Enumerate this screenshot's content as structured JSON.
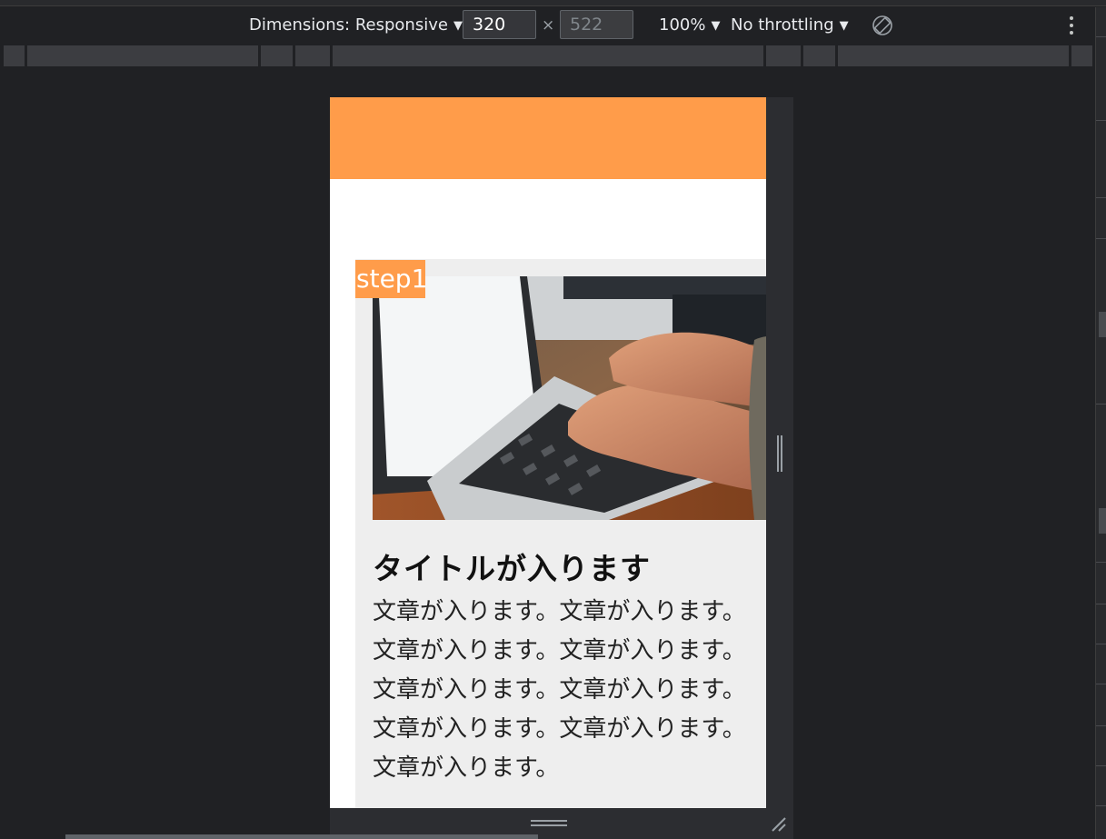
{
  "toolbar": {
    "dimensions_label": "Dimensions: Responsive",
    "width_value": "320",
    "height_placeholder": "522",
    "times_sign": "×",
    "zoom_label": "100%",
    "throttling_label": "No throttling"
  },
  "icons": {
    "caret": "▼",
    "rotate": "rotate-icon",
    "more": "more-vert-icon"
  },
  "colors": {
    "accent": "#ff9c4a",
    "devtools_bg": "#202124",
    "card_bg": "#eeeeee"
  },
  "viewport": {
    "step_badge": "step1",
    "card_title": "タイトルが入ります",
    "card_body_lines": [
      "文章が入ります。文章が入ります。",
      "文章が入ります。文章が入ります。",
      "文章が入ります。文章が入ります。",
      "文章が入ります。文章が入ります。",
      "文章が入ります。"
    ]
  }
}
